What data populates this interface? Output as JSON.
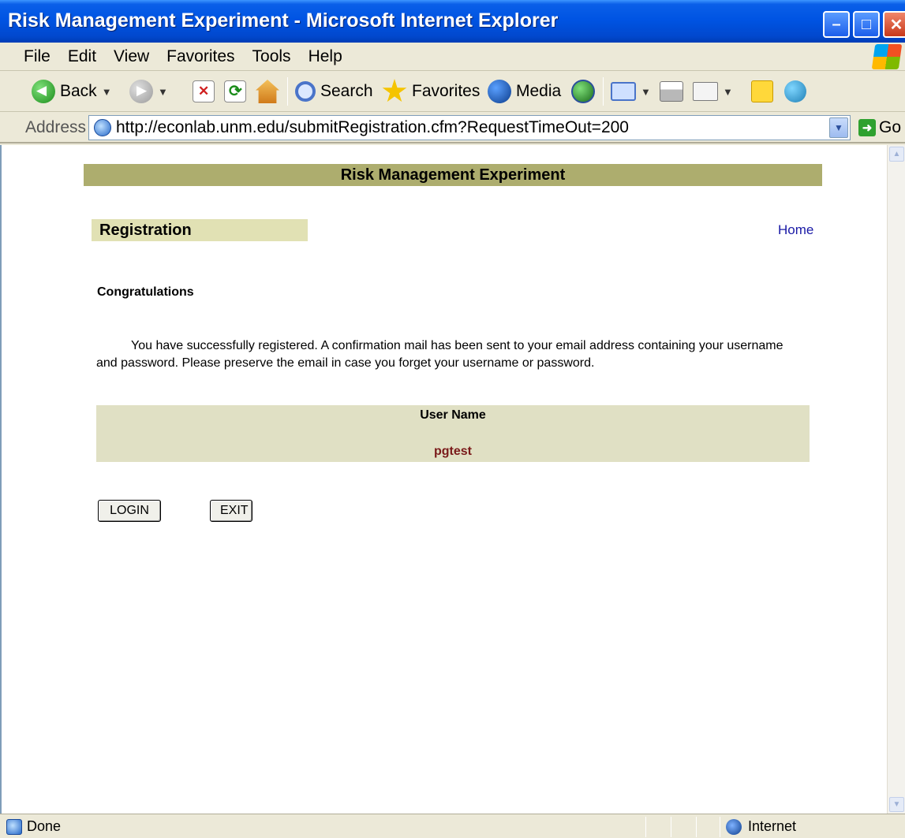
{
  "window": {
    "title": "Risk Management Experiment - Microsoft Internet Explorer"
  },
  "menu": {
    "items": [
      "File",
      "Edit",
      "View",
      "Favorites",
      "Tools",
      "Help"
    ]
  },
  "toolbar": {
    "back_label": "Back",
    "search_label": "Search",
    "favorites_label": "Favorites",
    "media_label": "Media"
  },
  "address": {
    "label": "Address",
    "url": "http://econlab.unm.edu/submitRegistration.cfm?RequestTimeOut=200",
    "go_label": "Go"
  },
  "page": {
    "header": "Risk Management Experiment",
    "section_title": "Registration",
    "home_link": "Home",
    "congrats_heading": "Congratulations",
    "message": "You have successfully registered. A confirmation mail has been sent to your email address containing your username and password. Please preserve the email in case you forget your username or password.",
    "user_table": {
      "header": "User Name",
      "value": "pgtest"
    },
    "buttons": {
      "login": "LOGIN",
      "exit": "EXIT"
    }
  },
  "status": {
    "left_text": "Done",
    "zone_text": "Internet"
  },
  "colors": {
    "header_bar": "#ADAD6E",
    "section_box": "#E1E1B4",
    "user_table_bg": "#E0E0C4",
    "username_color": "#7A1A1A",
    "link_color": "#1A1AA6"
  }
}
